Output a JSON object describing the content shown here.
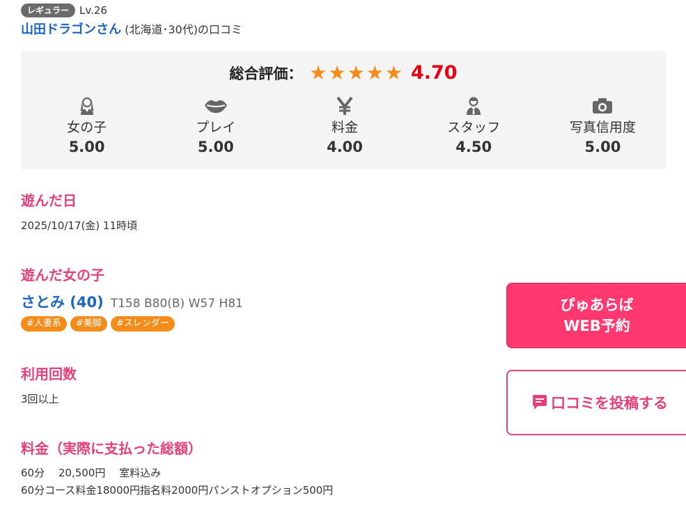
{
  "reviewer": {
    "level_badge": "レギュラー",
    "level": "Lv.26",
    "name": "山田ドラゴンさん",
    "meta": " (北海道･30代)の口コミ"
  },
  "rating": {
    "overall_label": "総合評価：",
    "overall_score": "4.70",
    "stars": 5,
    "categories": [
      {
        "label": "女の子",
        "value": "5.00",
        "icon": "woman-icon"
      },
      {
        "label": "プレイ",
        "value": "5.00",
        "icon": "lips-icon"
      },
      {
        "label": "料金",
        "value": "4.00",
        "icon": "yen-icon"
      },
      {
        "label": "スタッフ",
        "value": "4.50",
        "icon": "staff-icon"
      },
      {
        "label": "写真信用度",
        "value": "5.00",
        "icon": "camera-icon"
      }
    ]
  },
  "visit_date": {
    "title": "遊んだ日",
    "value": "2025/10/17(金) 11時頃"
  },
  "girl": {
    "title": "遊んだ女の子",
    "name": "さとみ (40)",
    "stats": "T158 B80(B) W57 H81",
    "tags": [
      "#人妻系",
      "#美脚",
      "#スレンダー"
    ]
  },
  "usage_count": {
    "title": "利用回数",
    "value": "3回以上"
  },
  "price": {
    "title": "料金（実際に支払った総額）",
    "line1": "60分　 20,500円　 室料込み",
    "line2": "60分コース料金18000円指名料2000円パンストオプション500円"
  },
  "buttons": {
    "web_line1": "ぴゅあらば",
    "web_line2": "WEB予約",
    "post": "口コミを投稿する"
  },
  "colors": {
    "accent_pink": "#e4407a",
    "star_orange": "#f58c1a",
    "score_red": "#e60012",
    "link_blue": "#1a66c2"
  }
}
